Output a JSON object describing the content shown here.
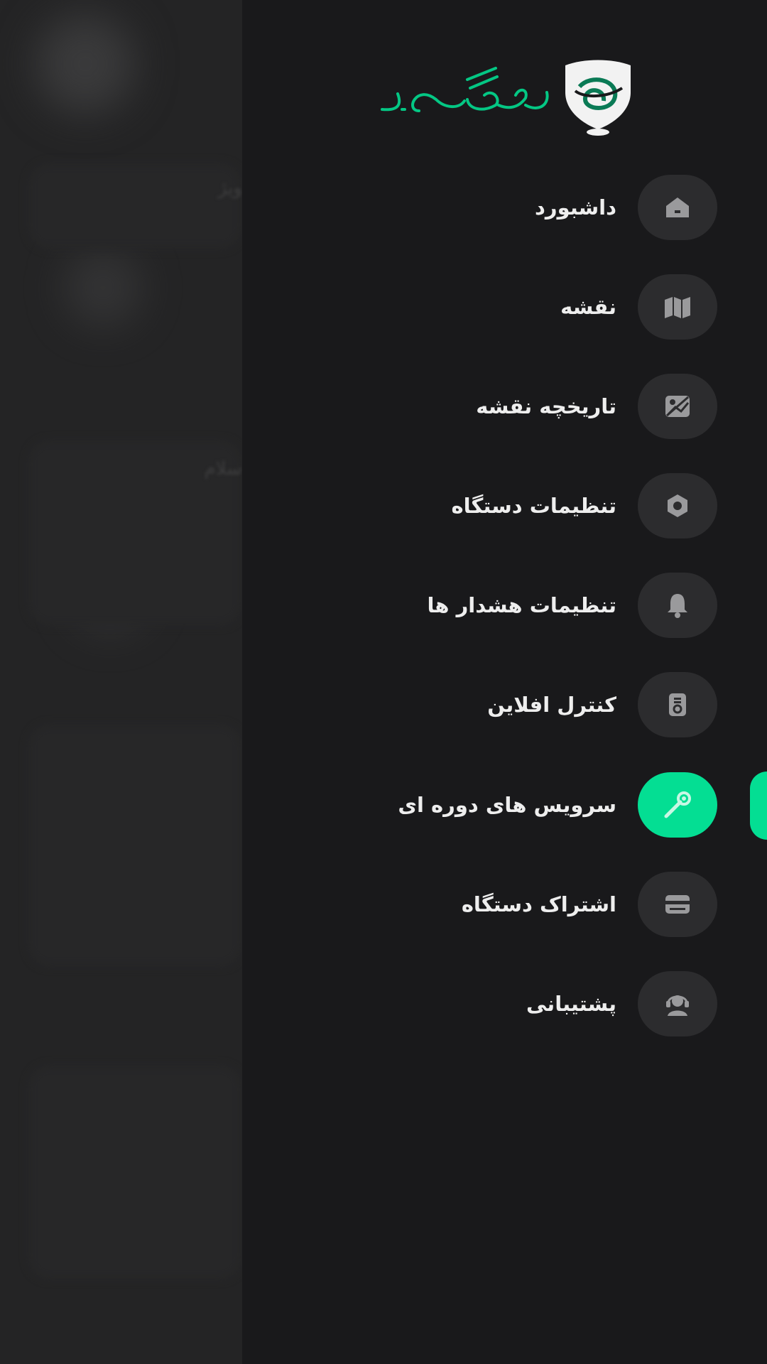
{
  "app": {
    "logo_text": "رهگاد",
    "accent_color": "#04de93",
    "drawer_bg": "#19191b"
  },
  "background": {
    "ghost_texts": [
      "ویژ",
      "سلام"
    ]
  },
  "menu": {
    "active_index": 6,
    "items": [
      {
        "label": "داشبورد",
        "icon": "home-icon"
      },
      {
        "label": "نقشه",
        "icon": "map-icon"
      },
      {
        "label": "تاریخچه نقشه",
        "icon": "image-history-icon"
      },
      {
        "label": "تنظیمات دستگاه",
        "icon": "settings-hex-icon"
      },
      {
        "label": "تنظیمات هشدار ها",
        "icon": "bell-icon"
      },
      {
        "label": "کنترل افلاین",
        "icon": "remote-control-icon"
      },
      {
        "label": "سرویس های دوره ای",
        "icon": "wrench-icon"
      },
      {
        "label": "اشتراک دستگاه",
        "icon": "card-icon"
      },
      {
        "label": "پشتیبانی",
        "icon": "headset-icon"
      }
    ]
  }
}
